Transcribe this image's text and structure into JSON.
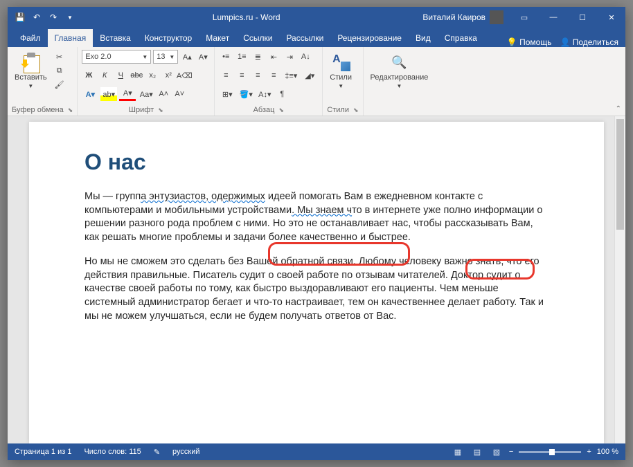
{
  "title": "Lumpics.ru - Word",
  "user": "Виталий Каиров",
  "tabs": {
    "file": "Файл",
    "home": "Главная",
    "insert": "Вставка",
    "design": "Конструктор",
    "layout": "Макет",
    "references": "Ссылки",
    "mailings": "Рассылки",
    "review": "Рецензирование",
    "view": "Вид",
    "help": "Справка",
    "tell": "Помощь",
    "share": "Поделиться"
  },
  "ribbon": {
    "clipboard": {
      "label": "Буфер обмена",
      "paste": "Вставить"
    },
    "font": {
      "label": "Шрифт",
      "name": "Exo 2.0",
      "size": "13"
    },
    "paragraph": {
      "label": "Абзац"
    },
    "styles": {
      "label": "Стили",
      "btn": "Стили"
    },
    "editing": {
      "label": "Редактирование"
    }
  },
  "document": {
    "heading": "О нас",
    "p1_a": "Мы — групп",
    "p1_wavy1": "а энтузиастов, одержимых",
    "p1_b": " идеей помогать Вам в ежедневном контакте с компьютерами и мобильными устройствами",
    "p1_wavy2": ". Мы знаем ч",
    "p1_c": "то в интернете уже полно информации о решении разного рода проблем с ними. Но это не останавливает нас, чтобы рассказывать Вам, как решать многие проблемы и задачи более качественно и быстрее.",
    "p2": "Но мы не сможем это сделать без Вашей обратной связи. Любому человеку важно знать, что его действия правильные. Писатель судит о своей работе по отзывам читателей. Доктор судит о качестве своей работы по тому, как быстро выздоравливают его пациенты. Чем меньше системный администратор бегает и что-то настраивает, тем он качественнее делает работу. Так и мы не можем улучшаться, если не будем получать ответов от Вас."
  },
  "status": {
    "page": "Страница 1 из 1",
    "words": "Число слов: 115",
    "lang": "русский",
    "zoom": "100 %"
  }
}
